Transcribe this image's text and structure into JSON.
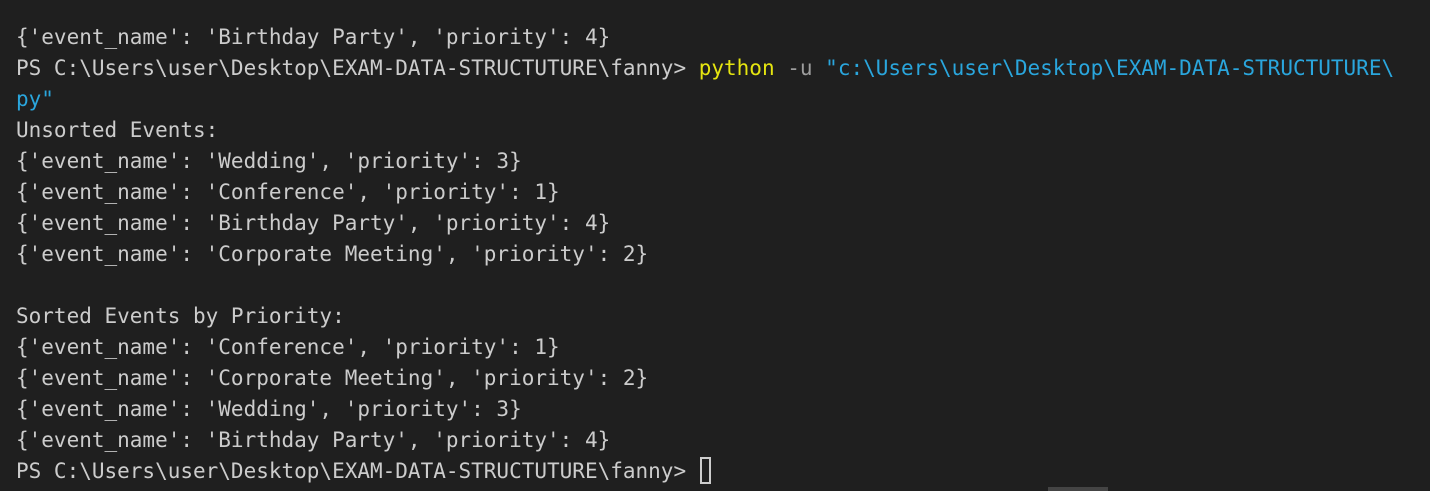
{
  "terminal": {
    "colors": {
      "background": "#1f1f1f",
      "text": "#cccccc",
      "command": "#e5e510",
      "flag": "#9d9d9d",
      "string": "#2aa6dd"
    },
    "lines": [
      "{'event_name': 'Birthday Party', 'priority': 4}",
      "Unsorted Events:",
      "{'event_name': 'Wedding', 'priority': 3}",
      "{'event_name': 'Conference', 'priority': 1}",
      "{'event_name': 'Birthday Party', 'priority': 4}",
      "{'event_name': 'Corporate Meeting', 'priority': 2}",
      "",
      "Sorted Events by Priority:",
      "{'event_name': 'Conference', 'priority': 1}",
      "{'event_name': 'Corporate Meeting', 'priority': 2}",
      "{'event_name': 'Wedding', 'priority': 3}",
      "{'event_name': 'Birthday Party', 'priority': 4}"
    ],
    "run_command": {
      "prompt": "PS C:\\Users\\user\\Desktop\\EXAM-DATA-STRUCTUTURE\\fanny> ",
      "command": "python",
      "flag": " -u ",
      "path_start": "\"c:\\Users\\user\\Desktop\\EXAM-DATA-STRUCTUTURE\\",
      "path_end": "py\""
    },
    "final_prompt": "PS C:\\Users\\user\\Desktop\\EXAM-DATA-STRUCTUTURE\\fanny> "
  }
}
